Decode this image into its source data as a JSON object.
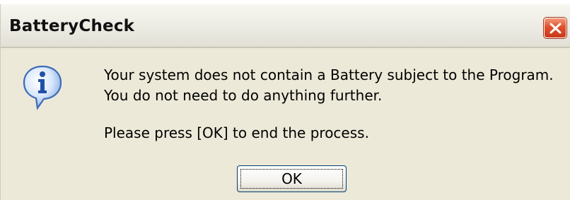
{
  "window": {
    "title": "BatteryCheck",
    "close_icon": "close-icon",
    "close_color": "#e0502c"
  },
  "message": {
    "icon": "information-icon",
    "line1": "Your system does not contain a Battery subject to the Program.",
    "line2": "You do not need to do anything further.",
    "line3": "Please press [OK] to end the process."
  },
  "buttons": {
    "ok_label": "OK"
  }
}
